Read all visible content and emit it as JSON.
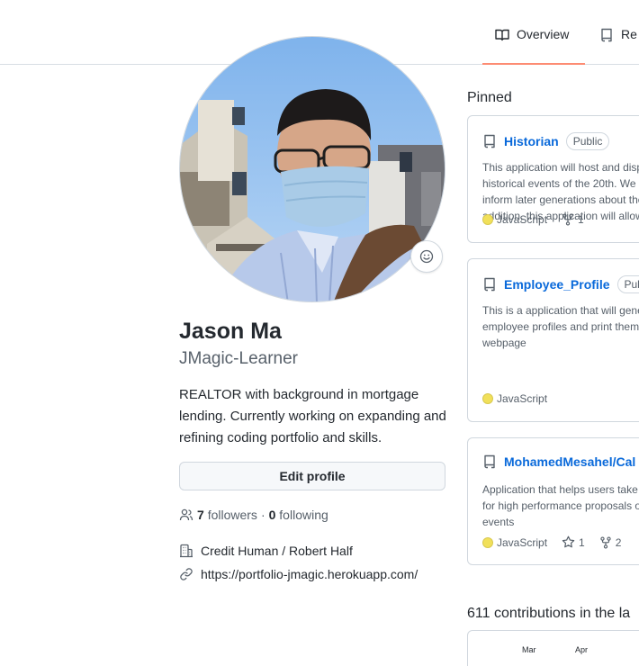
{
  "nav": {
    "tabs": [
      {
        "label": "Overview",
        "icon": "book-icon",
        "selected": true
      },
      {
        "label": "Re",
        "icon": "repo-icon",
        "selected": false
      }
    ],
    "selected_underline_color": "#fd8c73"
  },
  "profile": {
    "full_name": "Jason Ma",
    "username": "JMagic-Learner",
    "bio": "REALTOR with background in mortgage lending. Currently working on expanding and refining coding portfolio and skills.",
    "edit_label": "Edit profile",
    "followers_count": "7",
    "followers_label": "followers",
    "separator": "·",
    "following_count": "0",
    "following_label": "following",
    "company": "Credit Human / Robert Half",
    "website": "https://portfolio-jmagic.herokuapp.com/"
  },
  "pinned": {
    "title": "Pinned",
    "items": [
      {
        "name": "Historian",
        "visibility": "Public",
        "description": "This application will host and display historical events of the 20th. We hope to inform later generations about them. In addition, this application will allow",
        "language": "JavaScript",
        "language_color": "#f1e05a",
        "forks": "1"
      },
      {
        "name": "Employee_Profile",
        "visibility": "Public",
        "description": "This is a application that will generate employee profiles and print them onto the webpage",
        "language": "JavaScript",
        "language_color": "#f1e05a"
      },
      {
        "name": "MohamedMesahel/Cal",
        "description": "Application that helps users take their views for high performance proposals of local events",
        "language": "JavaScript",
        "language_color": "#f1e05a",
        "stars": "1",
        "forks": "2"
      }
    ]
  },
  "contributions": {
    "title": "611 contributions in the la",
    "months": [
      "Mar",
      "Apr"
    ]
  }
}
